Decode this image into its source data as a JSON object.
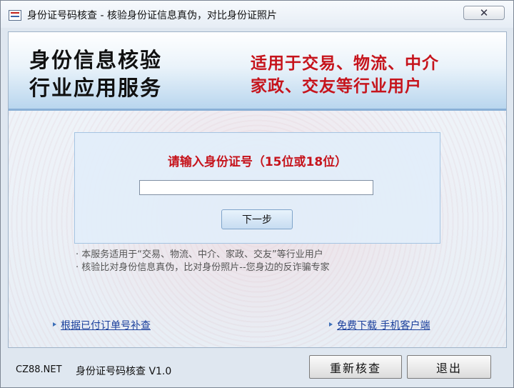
{
  "window": {
    "title": "身份证号码核查 -  核验身份证信息真伪，对比身份证照片",
    "close_label": "✕"
  },
  "banner": {
    "left_line1": "身份信息核验",
    "left_line2": "行业应用服务",
    "right_line1": "适用于交易、物流、中介",
    "right_line2": "家政、交友等行业用户"
  },
  "form": {
    "prompt": "请输入身份证号（15位或18位）",
    "id_value": "",
    "id_placeholder": "",
    "next_label": "下一步"
  },
  "notes": [
    "· 本服务适用于“交易、物流、中介、家政、交友”等行业用户",
    "· 核验比对身份信息真伪，比对身份照片--您身边的反诈骗专家"
  ],
  "links": {
    "reorder_lookup": "根据已付订单号补查",
    "download_app": "免费下载 手机客户端"
  },
  "footer": {
    "brand": "CZ88.NET",
    "version": "身份证号码核查 V1.0",
    "recheck_label": "重新核查",
    "exit_label": "退出"
  },
  "colors": {
    "accent_red": "#c6141c",
    "link_blue": "#1a3f9c",
    "banner_blue": "#b9d6ee"
  },
  "icons": {
    "app": "id-card-icon",
    "link_bullet": "arrow-right-icon"
  }
}
